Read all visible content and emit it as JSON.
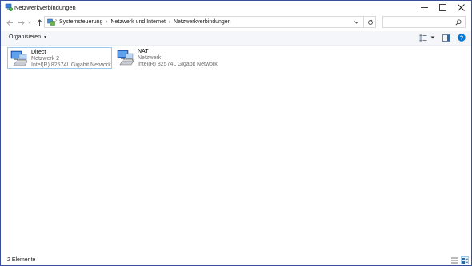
{
  "window": {
    "title": "Netzwerkverbindungen",
    "icon": "network-connections-icon",
    "controls": [
      "minimize-icon",
      "maximize-icon",
      "close-icon"
    ]
  },
  "nav": {
    "back_icon": "arrow-left-icon",
    "forward_icon": "arrow-right-icon",
    "recent_icon": "chevron-down-icon",
    "up_icon": "arrow-up-icon"
  },
  "address": {
    "breadcrumbs": [
      "Systemsteuerung",
      "Netzwerk und Internet",
      "Netzwerkverbindungen"
    ],
    "search_placeholder": ""
  },
  "toolbar": {
    "organize_label": "Organisieren"
  },
  "connections": [
    {
      "name": "Direct",
      "network": "Netzwerk 2",
      "device": "Intel(R) 82574L Gigabit Network C...",
      "selected": true
    },
    {
      "name": "NAT",
      "network": "Netzwerk",
      "device": "Intel(R) 82574L Gigabit Network C...",
      "selected": false
    }
  ],
  "status": {
    "item_count": "2 Elemente"
  },
  "colors": {
    "accent": "#0078d7",
    "selection_border": "#99c9ef",
    "window_border": "#3a4ea0",
    "toolbar_bg": "#f4f6f9"
  }
}
